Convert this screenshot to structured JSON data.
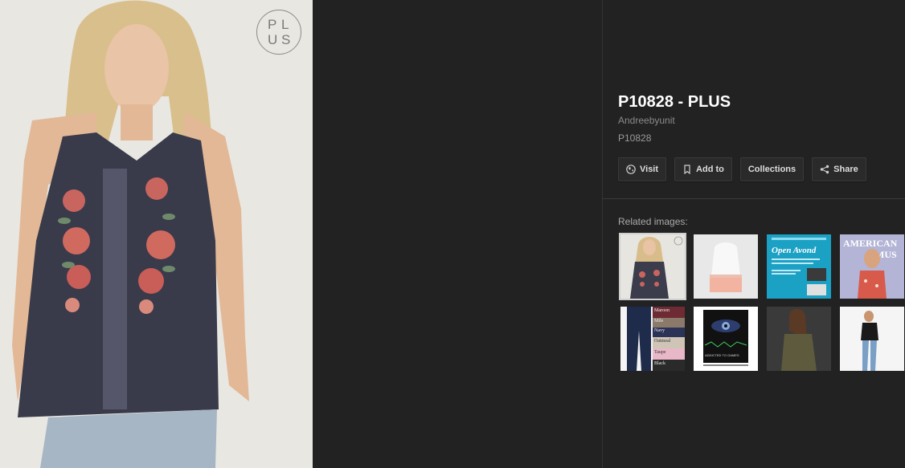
{
  "main_image": {
    "watermark_letters": [
      "P",
      "L",
      "U",
      "S"
    ]
  },
  "details": {
    "title": "P10828 - PLUS",
    "source": "Andreebyunit",
    "caption": "P10828"
  },
  "actions": [
    {
      "label": "Visit",
      "icon": "globe-icon"
    },
    {
      "label": "Add to",
      "icon": "bookmark-icon"
    },
    {
      "label": "Collections",
      "icon": ""
    },
    {
      "label": "Share",
      "icon": "share-icon"
    }
  ],
  "related": {
    "label": "Related images:",
    "thumb3_heading": "Open Avond",
    "thumb4_text": [
      "AMERICAN",
      "MUS"
    ],
    "thumb5_colors": [
      "Maroon",
      "Mile",
      "Navy",
      "Oatmeal",
      "Taupe",
      "Black"
    ],
    "thumb6_text": "ADDICTED TO GAMES"
  },
  "colors": {
    "background": "#222222",
    "text_primary": "#ffffff",
    "text_secondary": "#8a8a8a"
  }
}
